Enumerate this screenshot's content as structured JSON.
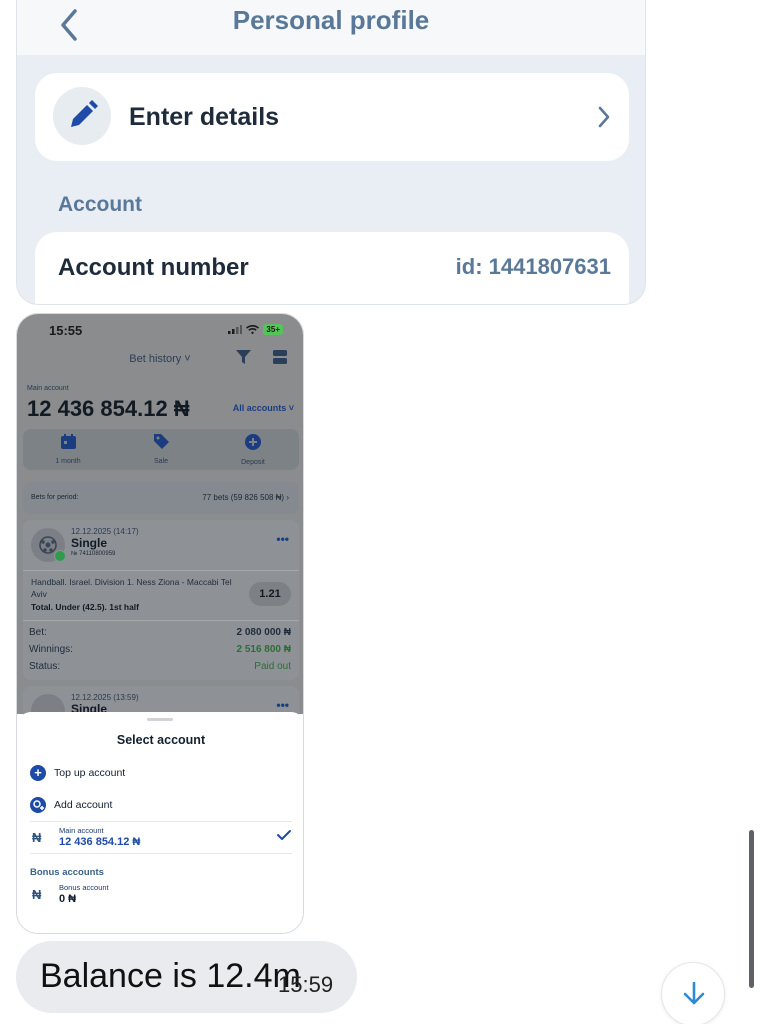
{
  "profile": {
    "title": "Personal profile",
    "enter_details": "Enter details",
    "account_section": "Account",
    "account_number_label": "Account number",
    "account_number_value": "id: 1441807631"
  },
  "phone": {
    "status_time": "15:55",
    "battery": "35+",
    "header_title": "Bet history ˅",
    "main_account_label": "Main account",
    "main_account_value": "12 436 854.12 ₦",
    "all_accounts": "All accounts ˅",
    "quick_actions": [
      {
        "label": "1 month",
        "icon": "calendar-icon"
      },
      {
        "label": "Sale",
        "icon": "tag-icon"
      },
      {
        "label": "Deposit",
        "icon": "plus-circle-icon"
      }
    ],
    "period_label": "Bets for period:",
    "period_value": "77 bets (59 826 508 ₦)",
    "bet1": {
      "date": "12.12.2025 (14:17)",
      "type": "Single",
      "number": "№ 74110800959",
      "event": "Handball. Israel. Division 1. Ness Ziona - Maccabi Tel Aviv",
      "market": "Total. Under (42.5). 1st half",
      "odds": "1.21",
      "bet_label": "Bet:",
      "bet_value": "2 080 000 ₦",
      "winnings_label": "Winnings:",
      "winnings_value": "2 516 800 ₦",
      "status_label": "Status:",
      "status_value": "Paid out"
    },
    "bet2": {
      "date": "12.12.2025 (13:59)",
      "type": "Single"
    },
    "sheet": {
      "title": "Select account",
      "top_up": "Top up account",
      "add": "Add account",
      "main_label": "Main account",
      "main_value": "12 436 854.12 ₦",
      "bonus_head": "Bonus accounts",
      "bonus_label": "Bonus account",
      "bonus_value": "0 ₦",
      "currency_symbol": "₦"
    }
  },
  "message": {
    "text": "Balance is 12.4m",
    "time": "15:59"
  },
  "colors": {
    "accent": "#1e4aa8",
    "title_blue": "#5a7999",
    "paid_green": "#2b6e35"
  }
}
